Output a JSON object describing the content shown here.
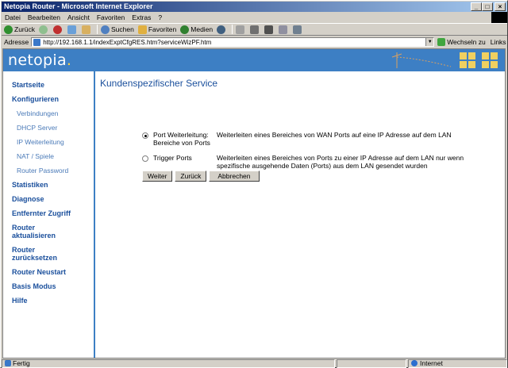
{
  "window": {
    "title": "Netopia Router - Microsoft Internet Explorer",
    "controls": {
      "minimize": "_",
      "maximize": "□",
      "close": "×"
    }
  },
  "menu": [
    "Datei",
    "Bearbeiten",
    "Ansicht",
    "Favoriten",
    "Extras",
    "?"
  ],
  "toolbar": {
    "back": "Zurück",
    "search": "Suchen",
    "favorites": "Favoriten",
    "media": "Medien"
  },
  "address": {
    "label": "Adresse",
    "url": "http://192.168.1.1/indexExptCfgRES.htm?serviceWizPF.htm",
    "go": "Wechseln zu",
    "links": "Links"
  },
  "brand": {
    "name": "netopia",
    "dot": "."
  },
  "sidebar": {
    "items": [
      {
        "label": "Startseite",
        "type": "main"
      },
      {
        "label": "Konfigurieren",
        "type": "main"
      },
      {
        "label": "Verbindungen",
        "type": "sub"
      },
      {
        "label": "DHCP Server",
        "type": "sub"
      },
      {
        "label": "IP Weiterleitung",
        "type": "sub"
      },
      {
        "label": "NAT / Spiele",
        "type": "sub"
      },
      {
        "label": "Router Password",
        "type": "sub"
      },
      {
        "label": "Statistiken",
        "type": "main"
      },
      {
        "label": "Diagnose",
        "type": "main"
      },
      {
        "label": "Entfernter Zugriff",
        "type": "main"
      },
      {
        "label": "Router aktualisieren",
        "type": "main"
      },
      {
        "label": "Router zurücksetzen",
        "type": "main"
      },
      {
        "label": "Router Neustart",
        "type": "main"
      },
      {
        "label": "Basis Modus",
        "type": "main"
      },
      {
        "label": "Hilfe",
        "type": "main"
      }
    ]
  },
  "main": {
    "title": "Kundenspezifischer Service",
    "options": [
      {
        "label": "Port Weiterleitung: Bereiche von Ports",
        "description": "Weiterleiten eines Bereiches von WAN Ports auf eine IP Adresse auf dem LAN",
        "selected": true
      },
      {
        "label": "Trigger Ports",
        "description": "Weiterleiten eines Bereiches von Ports zu einer IP Adresse auf dem LAN nur wenn spezifische ausgehende Daten (Ports) aus dem LAN gesendet wurden",
        "selected": false
      }
    ],
    "buttons": {
      "next": "Weiter",
      "back": "Zurück",
      "cancel": "Abbrechen"
    }
  },
  "status": {
    "left": "Fertig",
    "zone": "Internet"
  },
  "colors": {
    "header": "#3d7fc4",
    "nav": "#1a4f9c",
    "accent": "#f0d060"
  }
}
